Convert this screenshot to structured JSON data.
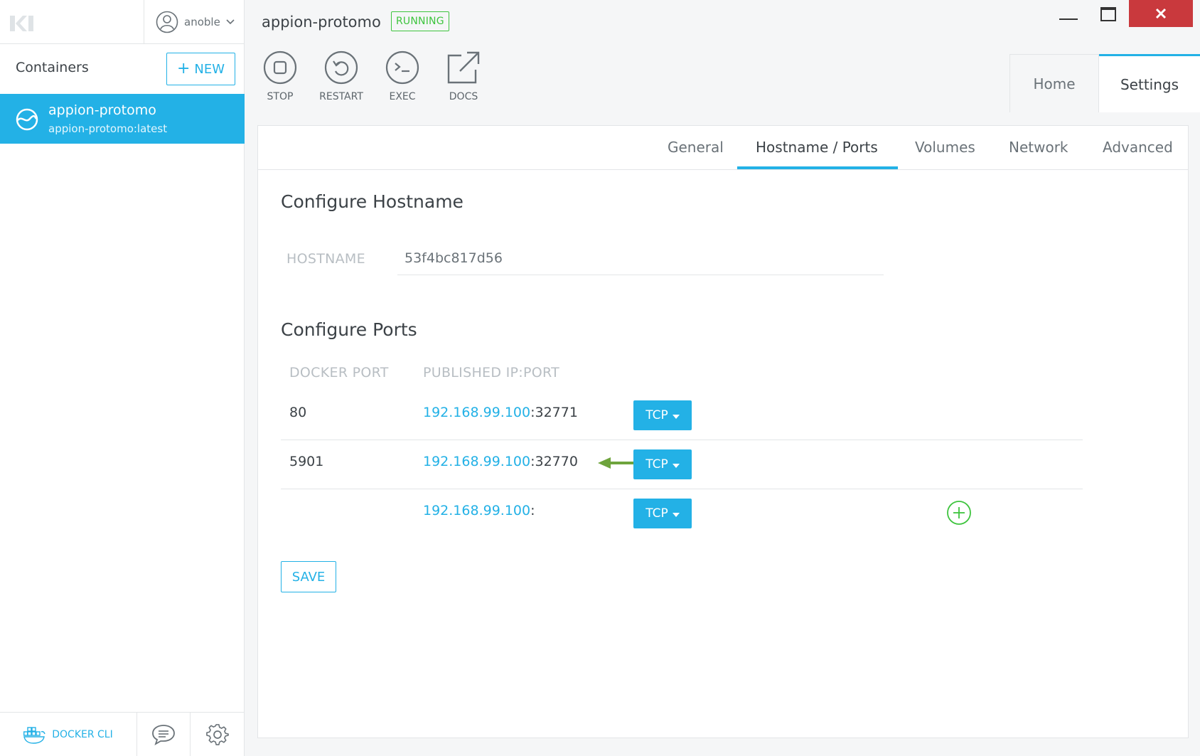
{
  "sidebar": {
    "user": "anoble",
    "containers_title": "Containers",
    "new_label": "NEW",
    "container": {
      "name": "appion-protomo",
      "image": "appion-protomo:latest"
    },
    "docker_cli_label": "DOCKER CLI"
  },
  "header": {
    "title": "appion-protomo",
    "status": "RUNNING",
    "actions": [
      {
        "label": "STOP",
        "icon": "stop-icon"
      },
      {
        "label": "RESTART",
        "icon": "restart-icon"
      },
      {
        "label": "EXEC",
        "icon": "terminal-icon"
      },
      {
        "label": "DOCS",
        "icon": "external-link-icon"
      }
    ],
    "tabs": [
      {
        "label": "Home"
      },
      {
        "label": "Settings",
        "active": true
      }
    ]
  },
  "settings": {
    "tabs": [
      {
        "label": "General"
      },
      {
        "label": "Hostname / Ports",
        "active": true
      },
      {
        "label": "Volumes"
      },
      {
        "label": "Network"
      },
      {
        "label": "Advanced"
      }
    ],
    "hostname_section_title": "Configure Hostname",
    "hostname_label": "HOSTNAME",
    "hostname_value": "53f4bc817d56",
    "ports_section_title": "Configure Ports",
    "col_docker_port": "DOCKER PORT",
    "col_published": "PUBLISHED IP:PORT",
    "ports": [
      {
        "docker_port": "80",
        "ip": "192.168.99.100",
        "port": ":32771",
        "protocol": "TCP"
      },
      {
        "docker_port": "5901",
        "ip": "192.168.99.100",
        "port": ":32770",
        "protocol": "TCP"
      },
      {
        "docker_port": "",
        "ip": "192.168.99.100",
        "port": ":",
        "protocol": "TCP"
      }
    ],
    "save_label": "SAVE"
  },
  "colors": {
    "accent": "#23b1e6",
    "running": "#3ec43e",
    "close": "#c9393d",
    "arrow": "#6ea43c"
  }
}
